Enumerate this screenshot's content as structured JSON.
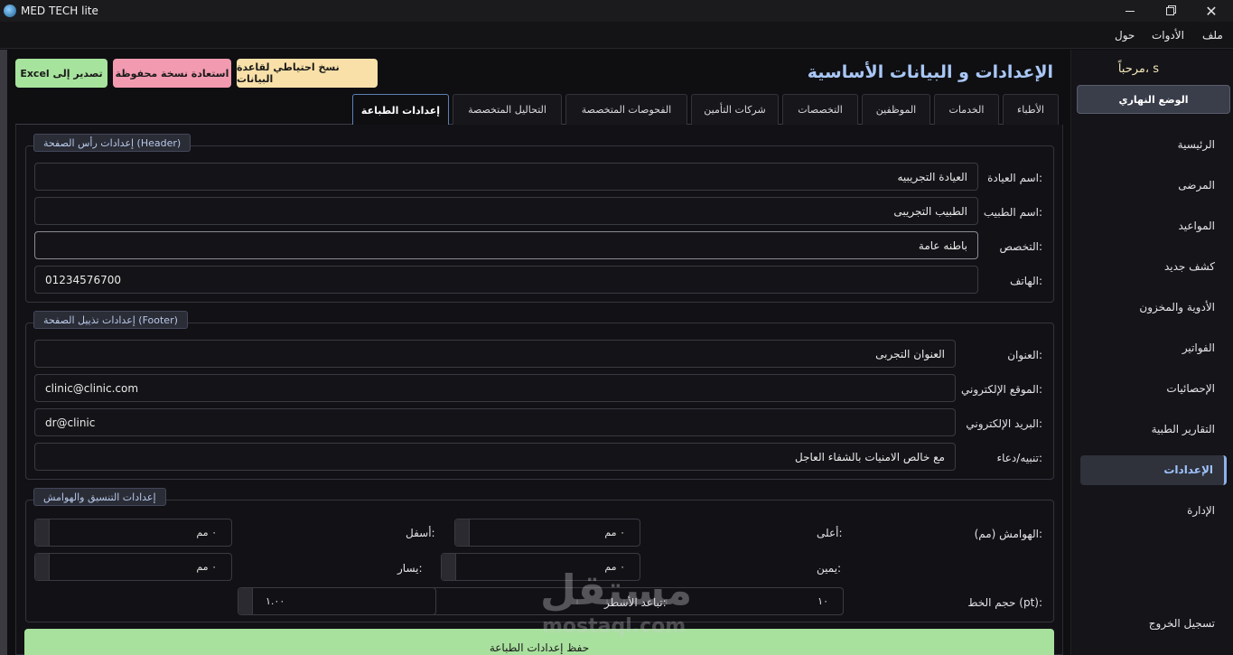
{
  "window": {
    "title": "MED TECH lite",
    "minimize": "",
    "maximize": "",
    "close": "✕"
  },
  "menu": {
    "file": "ملف",
    "tools": "الأدوات",
    "about": "حول"
  },
  "sidebar": {
    "welcome": "مرحباً، s",
    "day_mode": "الوضع النهاري",
    "items": [
      {
        "label": "الرئيسية"
      },
      {
        "label": "المرضى"
      },
      {
        "label": "المواعيد"
      },
      {
        "label": "كشف جديد"
      },
      {
        "label": "الأدوية والمخزون"
      },
      {
        "label": "الفواتير"
      },
      {
        "label": "الإحصائيات"
      },
      {
        "label": "التقارير الطبية"
      },
      {
        "label": "الإعدادات"
      },
      {
        "label": "الإدارة"
      },
      {
        "label": "تسجيل الخروج"
      }
    ]
  },
  "header": {
    "title": "الإعدادات و البيانات الأساسية",
    "backup_label": "نسخ احتياطي لقاعدة البيانات",
    "restore_label": "استعادة نسخة محفوظة",
    "excel_label": "Excel تصدير إلى"
  },
  "tabs": [
    {
      "label": "الأطباء"
    },
    {
      "label": "الخدمات"
    },
    {
      "label": "الموظفين"
    },
    {
      "label": "التخصصات"
    },
    {
      "label": "شركات التأمين"
    },
    {
      "label": "الفحوصات المتخصصة"
    },
    {
      "label": "التحاليل المتخصصة"
    },
    {
      "label": "إعدادات الطباعة"
    }
  ],
  "header_settings": {
    "title": "إعدادات رأس الصفحة (Header)",
    "clinic_name_label": "اسم العيادة:",
    "clinic_name": "العيادة التجريبيه",
    "doctor_name_label": "اسم الطبيب:",
    "doctor_name": "الطبيب التجريبى",
    "specialty_label": "التخصص:",
    "specialty": "باطنه عامة",
    "phone_label": "الهاتف:",
    "phone": "01234576700"
  },
  "footer_settings": {
    "title": "إعدادات تذييل الصفحة (Footer)",
    "address_label": "العنوان:",
    "address": "العنوان التجربى",
    "website_label": "الموقع الإلكتروني:",
    "website": "clinic@clinic.com",
    "email_label": "البريد الإلكتروني:",
    "email": "dr@clinic",
    "note_label": "تنبيه/دعاء:",
    "note": "مع خالص الامنيات بالشفاء العاجل"
  },
  "layout_settings": {
    "title": "إعدادات التنسيق والهوامش",
    "margins_label": "الهوامش (مم):",
    "top_label": "أعلى:",
    "top_value": "٠ مم",
    "bottom_label": "أسفل:",
    "bottom_value": "٠ مم",
    "right_label": "يمين:",
    "right_value": "٠ مم",
    "left_label": "يسار:",
    "left_value": "٠ مم",
    "font_size_label": "حجم الخط (pt):",
    "font_size_value": "١٠",
    "line_spacing_label": "تباعد الأسطر:",
    "line_spacing_value": "١.٠٠"
  },
  "save_label": "حفظ إعدادات الطباعة",
  "watermark": {
    "main": "مستقل",
    "sub": "mostaql.com"
  }
}
